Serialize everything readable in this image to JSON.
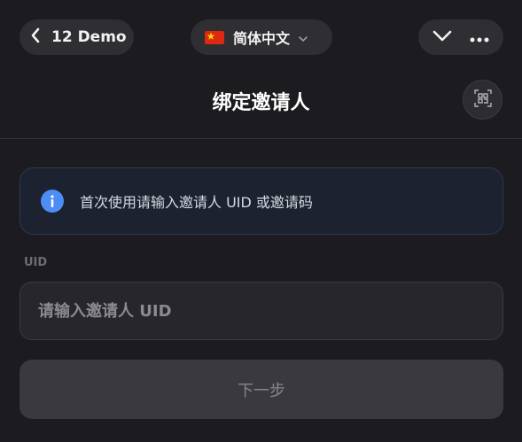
{
  "topbar": {
    "back_label": "12 Demo",
    "language_label": "简体中文",
    "icons": [
      "back-chevron-icon",
      "china-flag-icon",
      "chevron-down-icon",
      "collapse-chevron-icon",
      "more-dots-icon"
    ]
  },
  "header": {
    "title": "绑定邀请人",
    "scan_icon": "qr-scan-icon"
  },
  "notice": {
    "text": "首次使用请输入邀请人 UID 或邀请码",
    "icon": "info-icon"
  },
  "form": {
    "uid_label": "UID",
    "uid_placeholder": "请输入邀请人 UID",
    "uid_value": "",
    "next_label": "下一步"
  },
  "colors": {
    "background": "#1c1c20",
    "pill": "#2e2e33",
    "info_accent": "#4e8df5",
    "button_disabled": "#39393e"
  }
}
